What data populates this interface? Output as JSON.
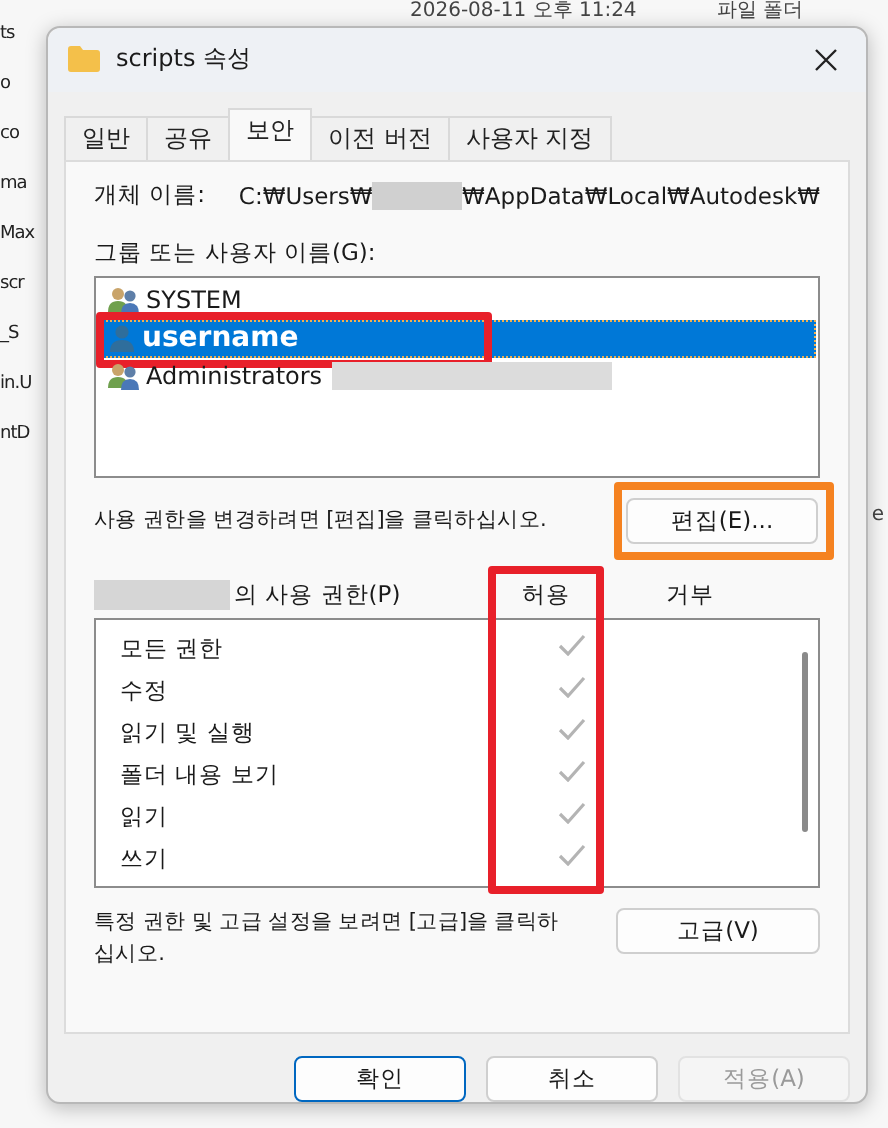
{
  "background": {
    "top_line": [
      "2026-08-11 오후 11:24",
      "파일 폴더"
    ],
    "fragments": [
      "ts",
      "o",
      "co",
      "ma",
      "Max",
      "scr",
      "_S",
      "in.U",
      "ntD"
    ],
    "right_fragment": "e"
  },
  "window": {
    "title": "scripts 속성"
  },
  "tabs": [
    {
      "label": "일반",
      "selected": false
    },
    {
      "label": "공유",
      "selected": false
    },
    {
      "label": "보안",
      "selected": true
    },
    {
      "label": "이전 버전",
      "selected": false
    },
    {
      "label": "사용자 지정",
      "selected": false
    }
  ],
  "object_name": {
    "label": "개체 이름:",
    "path_start": "C:₩Users₩",
    "path_end": "₩AppData₩Local₩Autodesk₩"
  },
  "groups": {
    "label": "그룹 또는 사용자 이름(G):",
    "items": [
      {
        "name": "SYSTEM",
        "kind": "group",
        "selected": false,
        "redacted": false,
        "highlighted": false
      },
      {
        "name": "username",
        "kind": "user",
        "selected": true,
        "redacted": false,
        "highlighted": true
      },
      {
        "name": "Administrators",
        "kind": "group",
        "selected": false,
        "redacted": true,
        "highlighted": false
      }
    ]
  },
  "edit_hint": "사용 권한을 변경하려면 [편집]을 클릭하십시오.",
  "edit_button": {
    "label": "편집(E)...",
    "highlighted": true
  },
  "permissions": {
    "label": "의 사용 권한(P)",
    "allow_header": "허용",
    "deny_header": "거부",
    "allow_highlighted": true,
    "rows": [
      {
        "name": "모든 권한",
        "allow": true,
        "deny": false,
        "disabled": true
      },
      {
        "name": "수정",
        "allow": true,
        "deny": false,
        "disabled": true
      },
      {
        "name": "읽기 및 실행",
        "allow": true,
        "deny": false,
        "disabled": true
      },
      {
        "name": "폴더 내용 보기",
        "allow": true,
        "deny": false,
        "disabled": true
      },
      {
        "name": "읽기",
        "allow": true,
        "deny": false,
        "disabled": true
      },
      {
        "name": "쓰기",
        "allow": true,
        "deny": false,
        "disabled": true
      }
    ]
  },
  "advanced_hint": "특정 권한 및 고급 설정을 보려면 [고급]을 클릭하십시오.",
  "advanced_button": "고급(V)",
  "buttons": [
    {
      "label": "확인",
      "default": true,
      "disabled": false
    },
    {
      "label": "취소",
      "default": false,
      "disabled": false
    },
    {
      "label": "적용(A)",
      "default": false,
      "disabled": true
    }
  ]
}
